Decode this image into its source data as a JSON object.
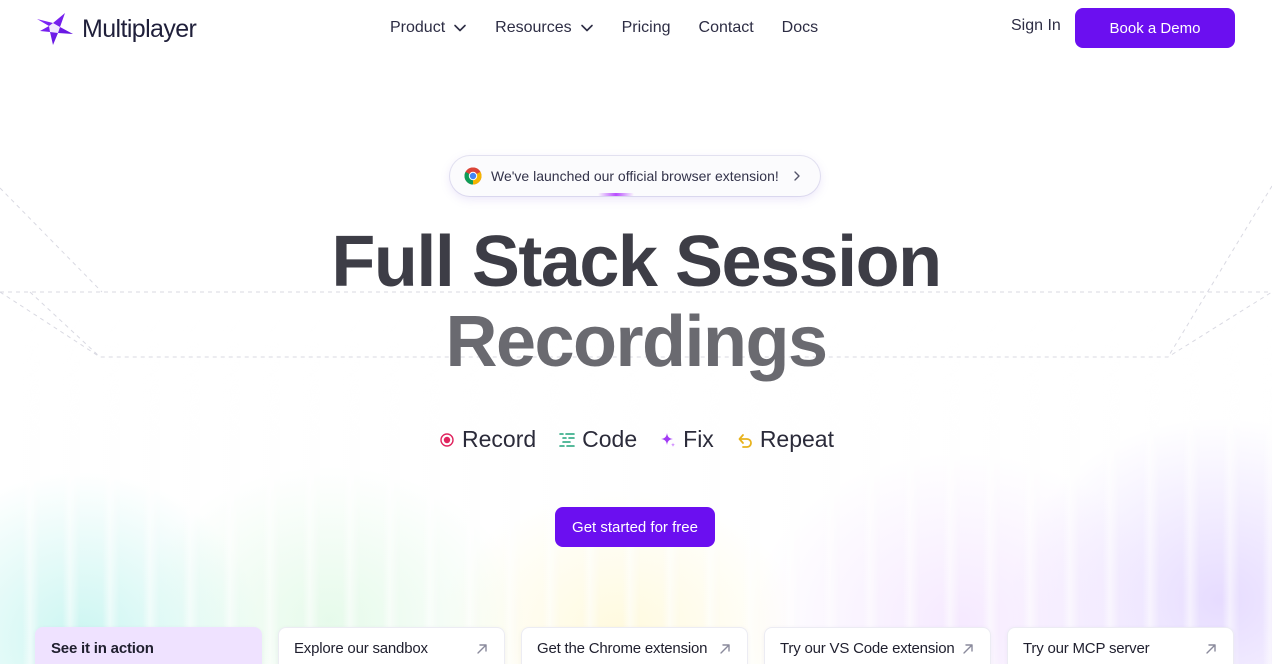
{
  "brand": {
    "name": "Multiplayer",
    "accent": "#6b0ff0"
  },
  "nav": {
    "items": [
      {
        "label": "Product",
        "dropdown": true
      },
      {
        "label": "Resources",
        "dropdown": true
      },
      {
        "label": "Pricing",
        "dropdown": false
      },
      {
        "label": "Contact",
        "dropdown": false
      },
      {
        "label": "Docs",
        "dropdown": false
      }
    ],
    "sign_in": "Sign In",
    "book_demo": "Book a Demo"
  },
  "announcement": {
    "icon": "chrome-icon",
    "text": "We've launched our official browser extension!"
  },
  "hero": {
    "title_line1": "Full Stack Session",
    "title_line2": "Recordings",
    "steps": [
      {
        "label": "Record",
        "icon": "record-icon",
        "color": "#e0245e"
      },
      {
        "label": "Code",
        "icon": "code-lines-icon",
        "color": "#1fa37a"
      },
      {
        "label": "Fix",
        "icon": "sparkle-icon",
        "color": "#a23bf5"
      },
      {
        "label": "Repeat",
        "icon": "undo-arrow-icon",
        "color": "#e8b21c"
      }
    ],
    "cta": "Get started for free"
  },
  "cards": [
    {
      "label": "See it in action",
      "active": true
    },
    {
      "label": "Explore our sandbox",
      "active": false
    },
    {
      "label": "Get the Chrome extension",
      "active": false
    },
    {
      "label": "Try our VS Code extension",
      "active": false
    },
    {
      "label": "Try our MCP server",
      "active": false
    }
  ]
}
